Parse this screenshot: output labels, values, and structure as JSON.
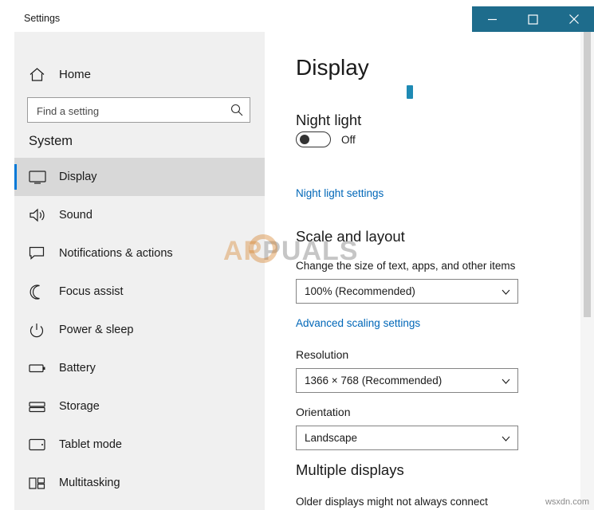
{
  "window": {
    "title": "Settings",
    "caption_buttons": [
      {
        "name": "minimize",
        "glyph": "minimize-icon"
      },
      {
        "name": "maximize",
        "glyph": "maximize-icon"
      },
      {
        "name": "close",
        "glyph": "close-icon"
      }
    ]
  },
  "sidebar": {
    "home_label": "Home",
    "search": {
      "placeholder": "Find a setting",
      "value": ""
    },
    "group_title": "System",
    "items": [
      {
        "label": "Display",
        "icon": "monitor-icon",
        "selected": true
      },
      {
        "label": "Sound",
        "icon": "speaker-icon",
        "selected": false
      },
      {
        "label": "Notifications & actions",
        "icon": "chat-bubble-icon",
        "selected": false
      },
      {
        "label": "Focus assist",
        "icon": "moon-icon",
        "selected": false
      },
      {
        "label": "Power & sleep",
        "icon": "power-icon",
        "selected": false
      },
      {
        "label": "Battery",
        "icon": "battery-icon",
        "selected": false
      },
      {
        "label": "Storage",
        "icon": "storage-icon",
        "selected": false
      },
      {
        "label": "Tablet mode",
        "icon": "tablet-icon",
        "selected": false
      },
      {
        "label": "Multitasking",
        "icon": "multitasking-icon",
        "selected": false
      }
    ]
  },
  "main": {
    "page_title": "Display",
    "night_light": {
      "heading": "Night light",
      "toggle_state": "Off",
      "toggle_on": false,
      "link": "Night light settings"
    },
    "scale_and_layout": {
      "heading": "Scale and layout",
      "size_label": "Change the size of text, apps, and other items",
      "size_value": "100% (Recommended)",
      "advanced_link": "Advanced scaling settings",
      "resolution_label": "Resolution",
      "resolution_value": "1366 × 768 (Recommended)",
      "orientation_label": "Orientation",
      "orientation_value": "Landscape"
    },
    "multiple_displays": {
      "heading": "Multiple displays",
      "note": "Older displays might not always connect"
    }
  },
  "watermark": {
    "brand_prefix": "AP",
    "brand_suffix": "PUALS",
    "corner": "wsxdn.com"
  },
  "colors": {
    "accent": "#0078d7",
    "titlebar": "#1e6c8c",
    "link": "#0067b8",
    "sidebar_bg": "#f0f0f0"
  }
}
